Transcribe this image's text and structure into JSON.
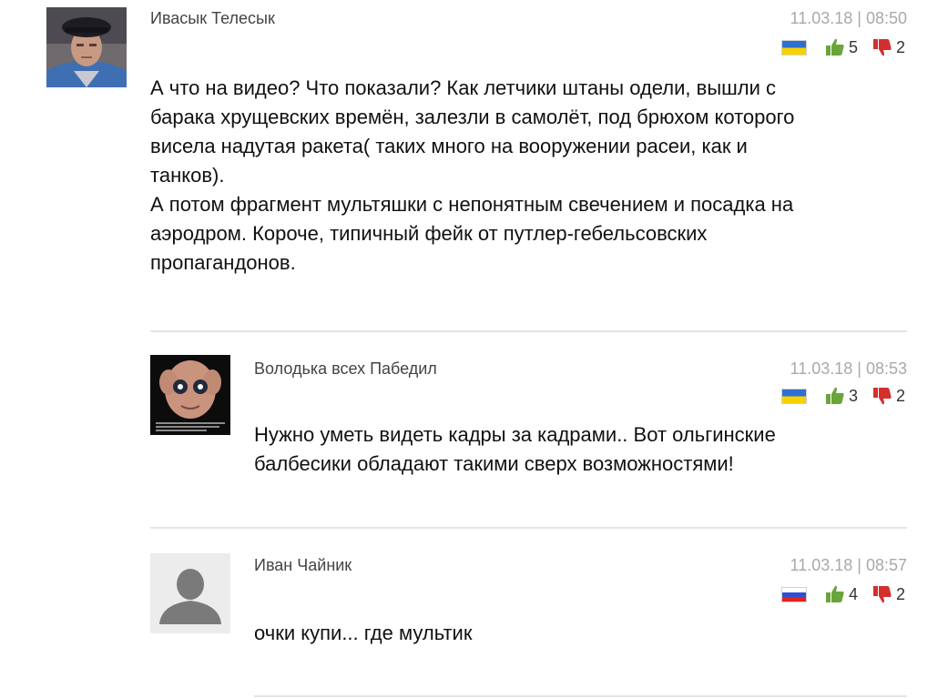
{
  "comments": [
    {
      "author": "Ивасык Телесык",
      "datetime": "11.03.18 | 08:50",
      "flag": "ukraine-flag",
      "likes": "5",
      "dislikes": "2",
      "text_lines": [
        "А что на видео? Что показали? Как летчики штаны одели, вышли с",
        "барака хрущевских времён, залезли в самолёт, под брюхом которого",
        "висела надутая ракета( таких много на вооружении расеи, как и",
        "танков).",
        "А потом фрагмент мультяшки с непонятным свечением и посадка на",
        "аэродром. Короче, типичный фейк от путлер-гебельсовских",
        "пропагандонов."
      ]
    },
    {
      "author": "Володька всех Пабедил",
      "datetime": "11.03.18 | 08:53",
      "flag": "ukraine-flag",
      "likes": "3",
      "dislikes": "2",
      "text_lines": [
        "Нужно уметь видеть кадры за кадрами.. Вот ольгинские",
        "балбесики обладают такими сверх возможностями!"
      ]
    },
    {
      "author": "Иван Чайник",
      "datetime": "11.03.18 | 08:57",
      "flag": "russia-flag",
      "likes": "4",
      "dislikes": "2",
      "text_lines": [
        "очки купи... где мультик"
      ]
    }
  ],
  "colors": {
    "thumb_up": "#6aa43a",
    "thumb_down": "#d2302f",
    "date": "#a9a9a9",
    "divider": "#e4e4e4"
  }
}
